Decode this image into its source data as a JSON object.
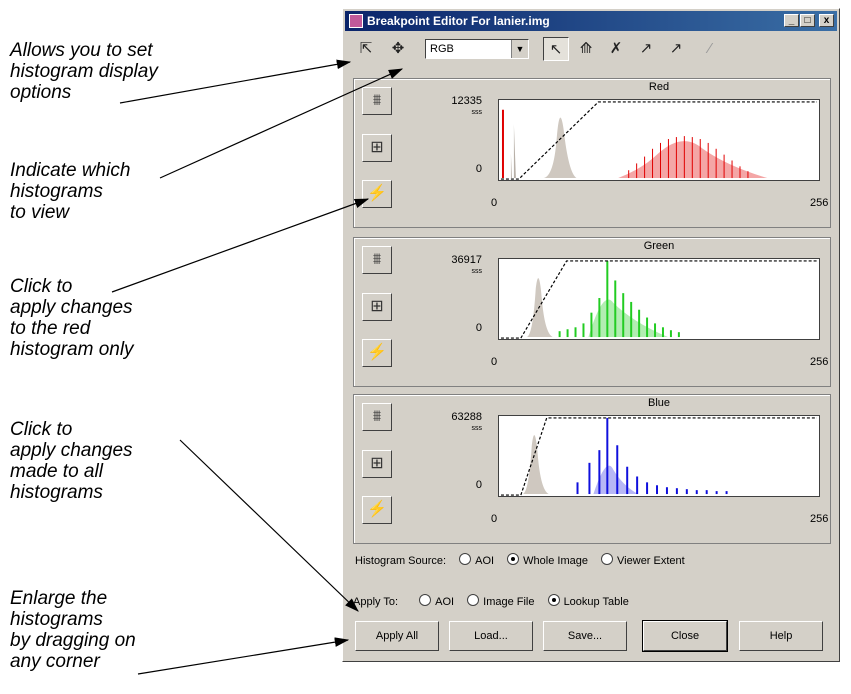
{
  "callouts": [
    {
      "lines": [
        "Allows you to set",
        "histogram display",
        "options"
      ]
    },
    {
      "lines": [
        "Indicate which",
        "histograms",
        "to view"
      ]
    },
    {
      "lines": [
        "Click to",
        "apply changes",
        "to the red",
        "histogram only"
      ]
    },
    {
      "lines": [
        "Click to",
        "apply changes",
        "made to all",
        "histograms"
      ]
    },
    {
      "lines": [
        "Enlarge the",
        "histograms",
        "by dragging on",
        "any corner"
      ]
    }
  ],
  "window": {
    "title": "Breakpoint Editor For lanier.img",
    "controls": [
      "_",
      "□",
      "x"
    ]
  },
  "toolbar": {
    "icons": [
      "histogram-options-icon",
      "move-icon",
      "select-arrow-icon",
      "insert-breakpoint-icon",
      "delete-breakpoint-icon",
      "curve-tool-icon",
      "curve-tool-alt-icon",
      "smooth-curve-icon"
    ],
    "channel_select": "RGB"
  },
  "panels": [
    {
      "title": "Red",
      "ymax": "12335",
      "ymin": "0",
      "xmin": "0",
      "xmax": "256",
      "color": "#e00000",
      "ysub": "sss"
    },
    {
      "title": "Green",
      "ymax": "36917",
      "ymin": "0",
      "xmin": "0",
      "xmax": "256",
      "color": "#22cc22",
      "ysub": "sss"
    },
    {
      "title": "Blue",
      "ymax": "63288",
      "ymin": "0",
      "xmin": "0",
      "xmax": "256",
      "color": "#1010dd",
      "ysub": "sss"
    }
  ],
  "histogram_source": {
    "label": "Histogram Source:",
    "options": [
      "AOI",
      "Whole Image",
      "Viewer Extent"
    ],
    "selected": "Whole Image"
  },
  "apply_to": {
    "label": "Apply To:",
    "options": [
      "AOI",
      "Image File",
      "Lookup Table"
    ],
    "selected": "Lookup Table"
  },
  "buttons": [
    "Apply All",
    "Load...",
    "Save...",
    "Close",
    "Help"
  ]
}
